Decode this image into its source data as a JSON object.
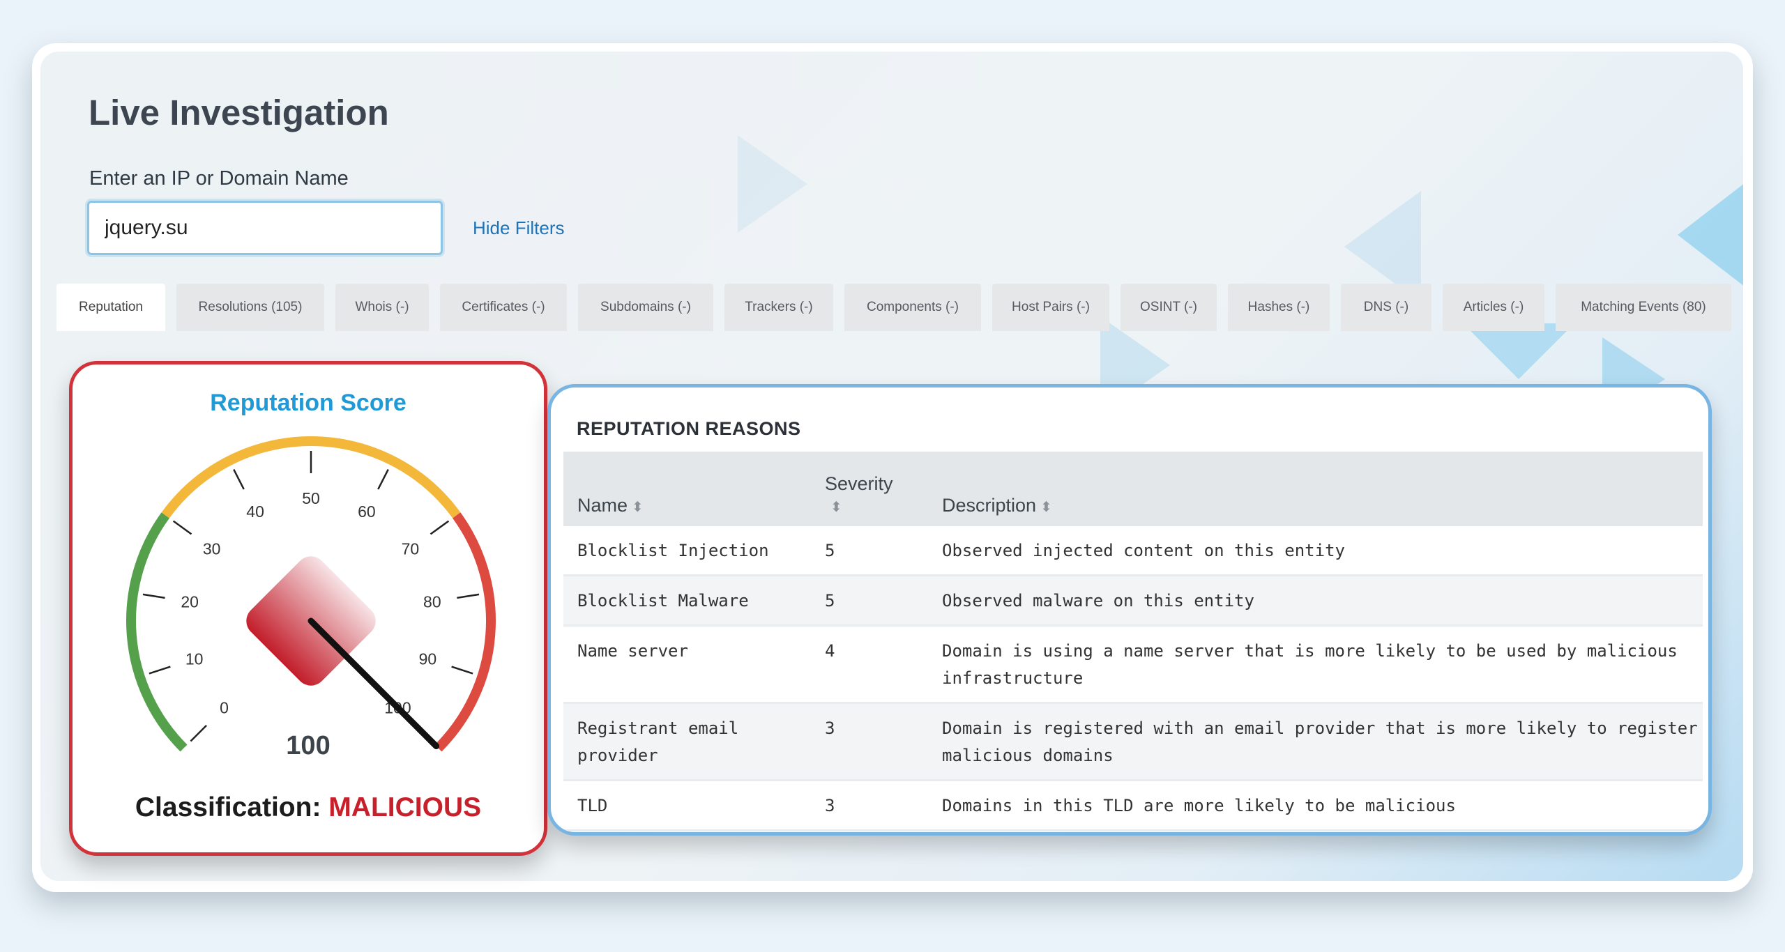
{
  "page": {
    "title": "Live Investigation"
  },
  "search": {
    "label": "Enter an IP or Domain Name",
    "value": "jquery.su",
    "hide_filters_label": "Hide Filters"
  },
  "tabs": [
    {
      "label": "Reputation",
      "active": true
    },
    {
      "label": "Resolutions (105)"
    },
    {
      "label": "Whois (-)"
    },
    {
      "label": "Certificates (-)"
    },
    {
      "label": "Subdomains (-)"
    },
    {
      "label": "Trackers (-)"
    },
    {
      "label": "Components (-)"
    },
    {
      "label": "Host Pairs (-)"
    },
    {
      "label": "OSINT (-)"
    },
    {
      "label": "Hashes (-)"
    },
    {
      "label": "DNS (-)"
    },
    {
      "label": "Articles (-)"
    },
    {
      "label": "Matching Events (80)"
    }
  ],
  "reputation": {
    "title": "Reputation Score",
    "score": "100",
    "classification_label": "Classification:",
    "classification_value": "MALICIOUS",
    "gauge": {
      "min": 0,
      "max": 100,
      "value": 100,
      "tick_labels": [
        "0",
        "10",
        "20",
        "30",
        "40",
        "50",
        "60",
        "70",
        "80",
        "90",
        "100"
      ],
      "bands": [
        {
          "from": 0,
          "to": 30,
          "color": "#55a04b"
        },
        {
          "from": 30,
          "to": 70,
          "color": "#f3b73a"
        },
        {
          "from": 70,
          "to": 100,
          "color": "#dc4a40"
        }
      ]
    }
  },
  "reasons": {
    "title": "REPUTATION REASONS",
    "columns": [
      {
        "label": "Name"
      },
      {
        "label": "Severity"
      },
      {
        "label": "Description"
      }
    ],
    "rows": [
      {
        "name": "Blocklist Injection",
        "severity": "5",
        "description": "Observed injected content on this entity"
      },
      {
        "name": "Blocklist Malware",
        "severity": "5",
        "description": "Observed malware on this entity"
      },
      {
        "name": "Name server",
        "severity": "4",
        "description": "Domain is using a name server that is more likely to be used by malicious infrastructure"
      },
      {
        "name": "Registrant email provider",
        "severity": "3",
        "description": "Domain is registered with an email provider that is more likely to register malicious domains"
      },
      {
        "name": "TLD",
        "severity": "3",
        "description": "Domains in this TLD are more likely to be malicious"
      }
    ]
  },
  "colors": {
    "malicious": "#c8202b",
    "accent": "#1f9ad6",
    "link": "#1f73b7"
  }
}
